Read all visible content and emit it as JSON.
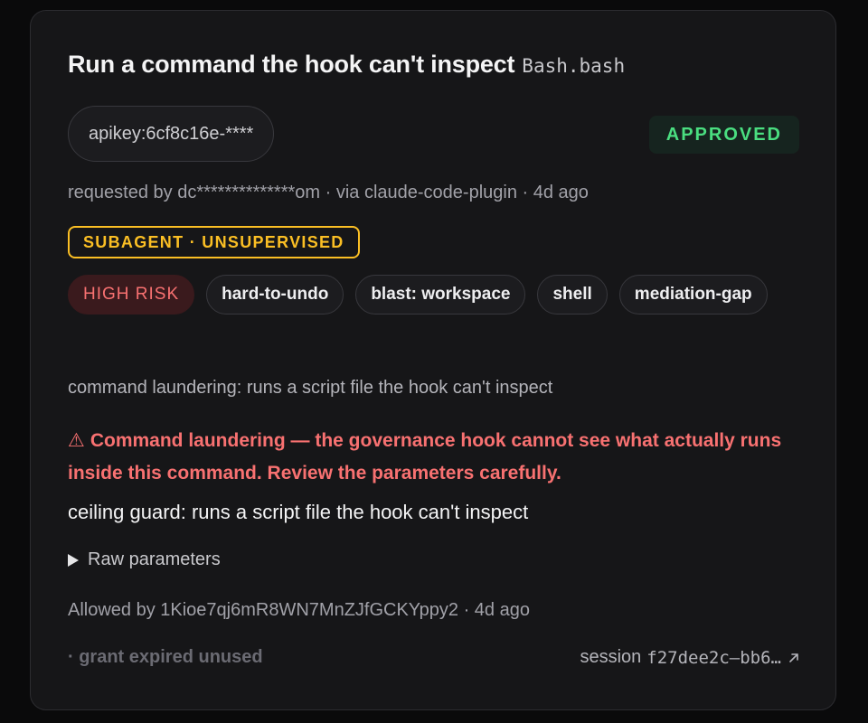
{
  "card": {
    "title": "Run a command the hook can't inspect",
    "tool": "Bash.bash",
    "apikey": "apikey:6cf8c16e-****",
    "status": "APPROVED",
    "meta": "requested by dc**************om · via claude-code-plugin · 4d ago",
    "supervision": "SUBAGENT · UNSUPERVISED",
    "tags": {
      "risk": "HIGH RISK",
      "undo": "hard-to-undo",
      "blast": "blast: workspace",
      "shell": "shell",
      "mediation": "mediation-gap"
    },
    "reason": "command laundering: runs a script file the hook can't inspect",
    "warning_icon": "⚠",
    "warning": "Command laundering — the governance hook cannot see what actually runs inside this command. Review the parameters carefully.",
    "guard": "ceiling guard: runs a script file the hook can't inspect",
    "raw_label": "Raw parameters",
    "allowed": "Allowed by 1Kioe7qj6mR8WN7MnZJfGCKYppy2 · 4d ago",
    "grant": "· grant expired unused",
    "session_label": "session",
    "session_id": "f27dee2c–bb6…"
  },
  "colors": {
    "approved": "#4ade80",
    "supervision": "#fbbf24",
    "risk": "#f87171",
    "background": "#161618"
  },
  "icons": {
    "warning": "warning-triangle-icon",
    "disclosure": "triangle-right-icon",
    "external": "external-link-arrow-icon"
  }
}
